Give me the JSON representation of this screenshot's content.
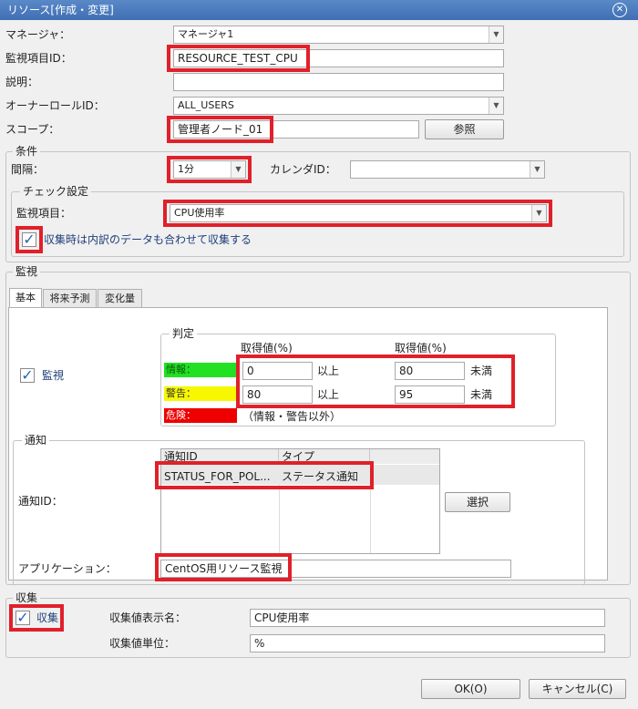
{
  "window": {
    "title": "リソース[作成・変更]"
  },
  "form": {
    "manager_label": "マネージャ：",
    "manager_value": "マネージャ1",
    "monitor_id_label": "監視項目ID：",
    "monitor_id_value": "RESOURCE_TEST_CPU",
    "description_label": "説明：",
    "description_value": "",
    "owner_role_label": "オーナーロールID：",
    "owner_role_value": "ALL_USERS",
    "scope_label": "スコープ：",
    "scope_value": "管理者ノード_01",
    "scope_button": "参照"
  },
  "conditions": {
    "legend": "条件",
    "interval_label": "間隔：",
    "interval_value": "1分",
    "calendar_label": "カレンダID：",
    "calendar_value": "",
    "check_legend": "チェック設定",
    "item_label": "監視項目：",
    "item_value": "CPU使用率",
    "breakdown_label": "収集時は内訳のデータも合わせて収集する",
    "breakdown_checked": true
  },
  "monitoring": {
    "legend": "監視",
    "tabs": [
      "基本",
      "将来予測",
      "変化量"
    ],
    "monitor_label": "監視",
    "monitor_checked": true,
    "judgement": {
      "legend": "判定",
      "col1_header": "取得値(%)",
      "col2_header": "取得値(%)",
      "info_label": "情報：",
      "warn_label": "警告：",
      "crit_label": "危険：",
      "info_from": "0",
      "info_from_suffix": "以上",
      "info_to": "80",
      "info_to_suffix": "未満",
      "warn_from": "80",
      "warn_from_suffix": "以上",
      "warn_to": "95",
      "warn_to_suffix": "未満",
      "crit_note": "（情報・警告以外）",
      "colors": {
        "info": "#22e022",
        "warn": "#f7f700",
        "crit": "#ee0000"
      }
    },
    "notification": {
      "legend": "通知",
      "id_label": "通知ID：",
      "col_id": "通知ID",
      "col_type": "タイプ",
      "rows": [
        {
          "id": "STATUS_FOR_POL...",
          "type": "ステータス通知"
        }
      ],
      "select_button": "選択",
      "app_label": "アプリケーション：",
      "app_value": "CentOS用リソース監視"
    }
  },
  "collection": {
    "legend": "収集",
    "collect_label": "収集",
    "collect_checked": true,
    "display_name_label": "収集値表示名：",
    "display_name_value": "CPU使用率",
    "unit_label": "収集値単位：",
    "unit_value": "%"
  },
  "footer": {
    "ok": "OK(O)",
    "cancel": "キャンセル(C)"
  }
}
